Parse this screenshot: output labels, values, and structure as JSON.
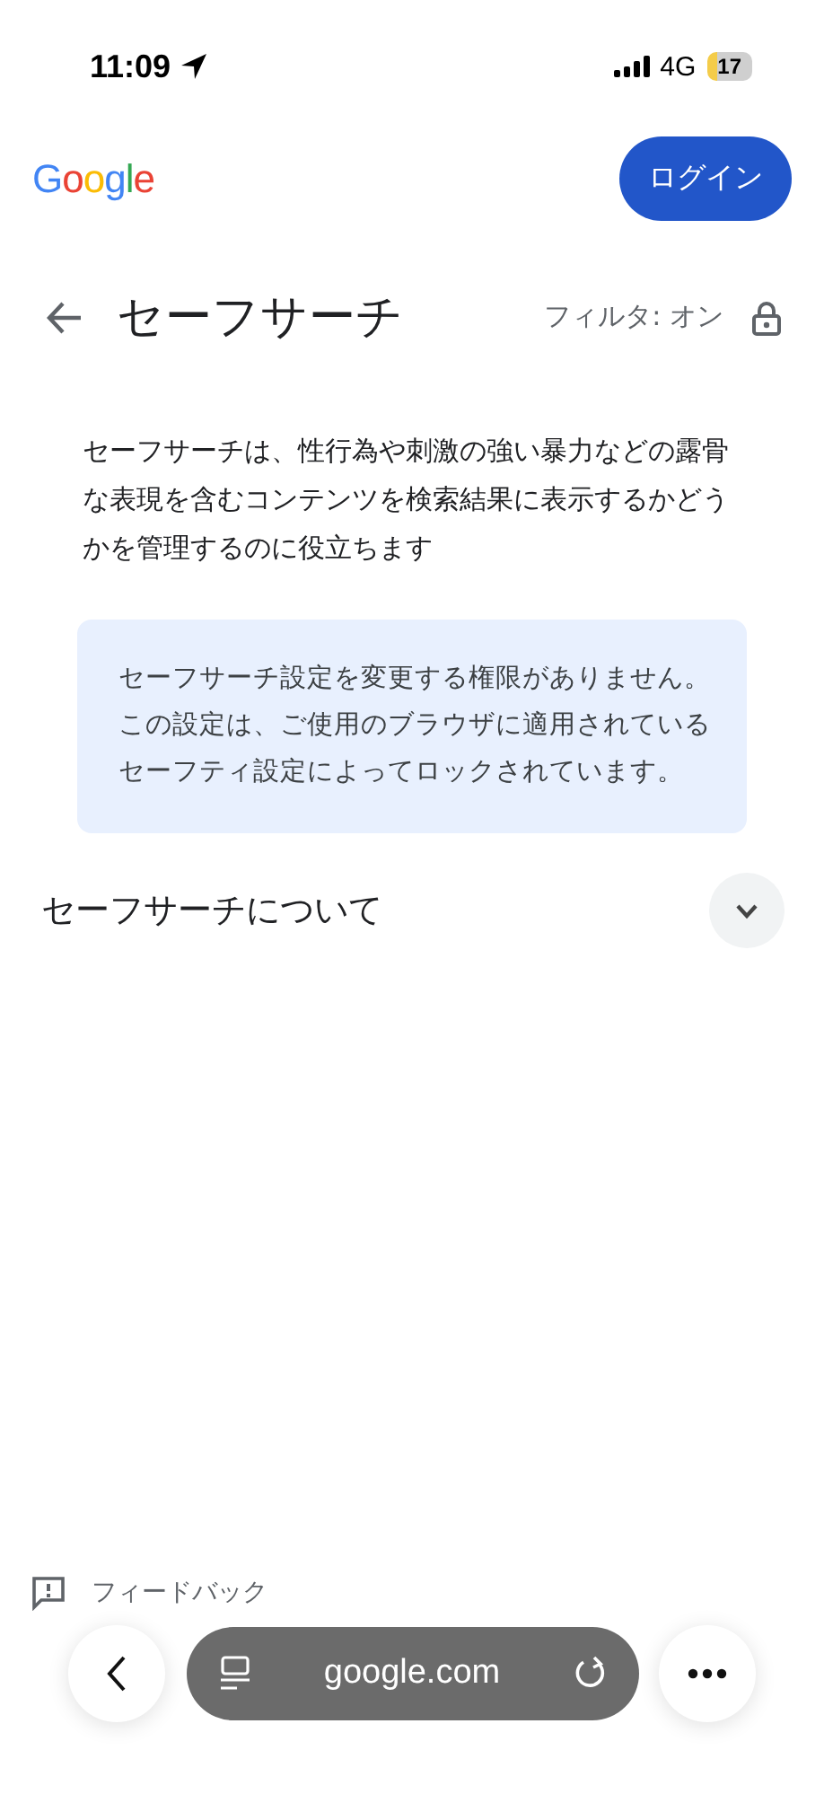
{
  "status_bar": {
    "time": "11:09",
    "network": "4G",
    "battery": "17"
  },
  "header": {
    "logo": "Google",
    "login_button": "ログイン"
  },
  "page": {
    "title": "セーフサーチ",
    "filter_status": "フィルタ: オン",
    "locked": true
  },
  "description": "セーフサーチは、性行為や刺激の強い暴力などの露骨な表現を含むコンテンツを検索結果に表示するかどうかを管理するのに役立ちます",
  "notice": "セーフサーチ設定を変更する権限がありません。この設定は、ご使用のブラウザに適用されているセーフティ設定によってロックされています。",
  "section": {
    "title": "セーフサーチについて",
    "expanded": false
  },
  "feedback": "フィードバック",
  "browser_bar": {
    "url": "google.com"
  }
}
